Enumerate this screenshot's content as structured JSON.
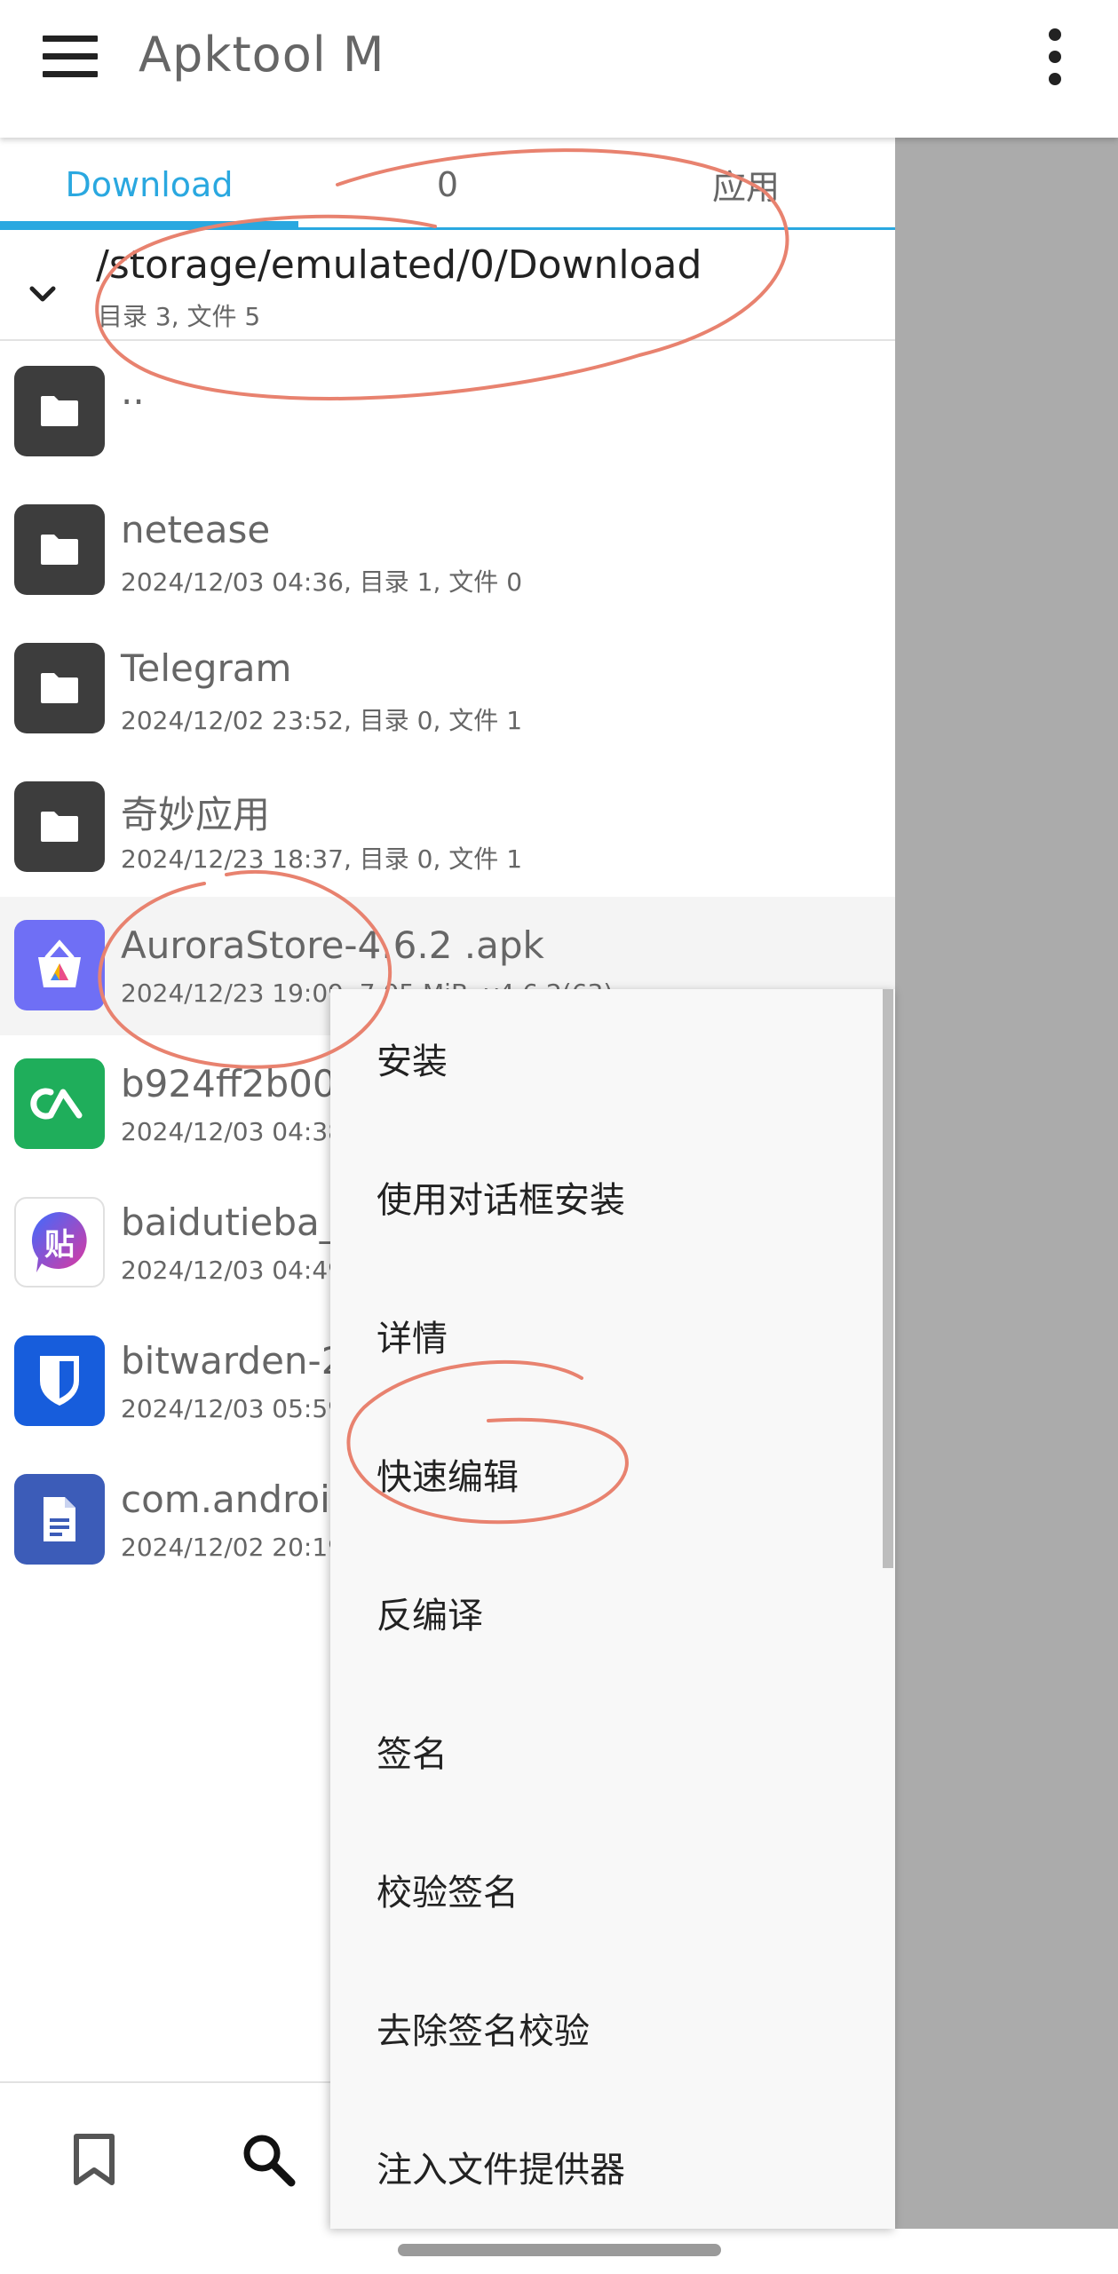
{
  "toolbar": {
    "title": "Apktool M"
  },
  "tabs": [
    {
      "label": "Download"
    },
    {
      "label": "0"
    },
    {
      "label": "应用"
    }
  ],
  "path": {
    "current": "/storage/emulated/0/Download",
    "summary": "目录 3, 文件 5"
  },
  "files": [
    {
      "name": "..",
      "meta": "",
      "icon": "folder-icon"
    },
    {
      "name": "netease",
      "meta": "2024/12/03 04:36, 目录 1, 文件 0",
      "icon": "folder-icon"
    },
    {
      "name": "Telegram",
      "meta": "2024/12/02 23:52, 目录 0, 文件 1",
      "icon": "folder-icon"
    },
    {
      "name": "奇妙应用",
      "meta": "2024/12/23 18:37, 目录 0, 文件 1",
      "icon": "folder-icon"
    },
    {
      "name": "AuroraStore-4.6.2 .apk",
      "meta": "2024/12/23 19:09, 7.05 MiB, v4.6.2(63)",
      "icon": "aurora-store-icon"
    },
    {
      "name": "b924ff2b00",
      "meta": "2024/12/03 04:38",
      "icon": "green-app-icon"
    },
    {
      "name": "baidutieba_",
      "meta": "2024/12/03 04:49",
      "icon": "tieba-icon"
    },
    {
      "name": "bitwarden-2",
      "meta": "2024/12/03 05:59",
      "icon": "bitwarden-icon"
    },
    {
      "name": "com.android",
      "meta": "2024/12/02 20:19",
      "icon": "document-icon"
    }
  ],
  "popup_menu": [
    {
      "label": "安装"
    },
    {
      "label": "使用对话框安装"
    },
    {
      "label": "详情"
    },
    {
      "label": "快速编辑"
    },
    {
      "label": "反编译"
    },
    {
      "label": "签名"
    },
    {
      "label": "校验签名"
    },
    {
      "label": "去除签名校验"
    },
    {
      "label": "注入文件提供器"
    }
  ],
  "colors": {
    "accent": "#2aa8e0",
    "annotation": "#e8826f",
    "scrim": "#ababab",
    "folder": "#3d3d3d"
  }
}
